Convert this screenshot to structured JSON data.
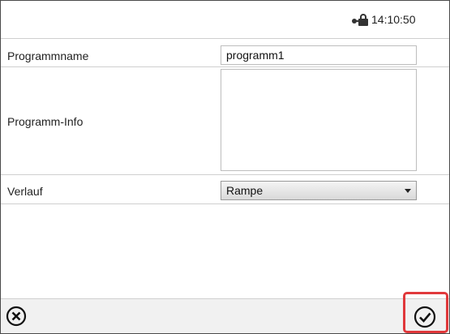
{
  "status_bar": {
    "time": "14:10:50",
    "icons": [
      "lock-icon"
    ]
  },
  "form": {
    "program_name": {
      "label": "Programmname",
      "value": "programm1"
    },
    "program_info": {
      "label": "Programm-Info",
      "value": ""
    },
    "curve": {
      "label": "Verlauf",
      "value": "Rampe"
    }
  },
  "footer": {
    "cancel_icon": "cancel-circle-icon",
    "confirm_icon": "checkmark-circle-icon",
    "highlight_color": "#e0383b"
  }
}
